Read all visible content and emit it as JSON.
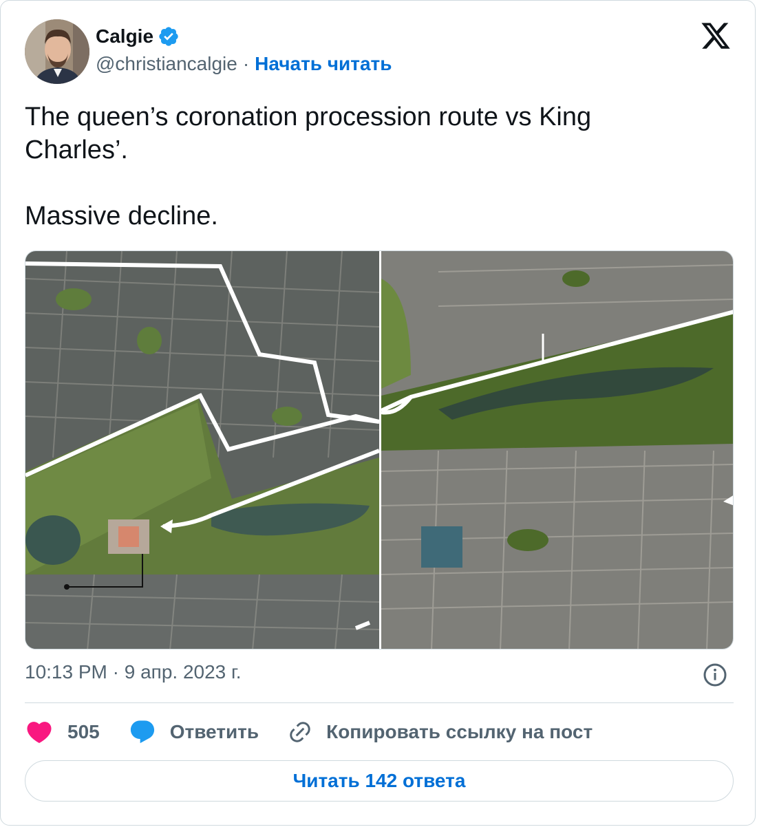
{
  "author": {
    "name": "Calgie",
    "handle": "@christiancalgie",
    "separator": "·",
    "follow_label": "Начать читать"
  },
  "tweet": {
    "text": "The queen’s coronation procession route vs King\nCharles’.\n\nMassive decline."
  },
  "meta": {
    "timestamp": "10:13 PM · 9 апр. 2023 г."
  },
  "actions": {
    "likes_count": "505",
    "reply_label": "Ответить",
    "copy_link_label": "Копировать ссылку на пост"
  },
  "replies_button": {
    "label": "Читать 142 ответа"
  },
  "icons": {
    "verified": "verified-badge-icon",
    "platform": "x-logo-icon",
    "info": "info-icon",
    "like": "heart-icon",
    "reply": "speech-bubble-icon",
    "copy": "link-icon"
  },
  "colors": {
    "accent": "#1d9bf0",
    "link": "#006fd6",
    "like": "#f91880",
    "muted": "#536471",
    "border": "#cfd9de"
  }
}
